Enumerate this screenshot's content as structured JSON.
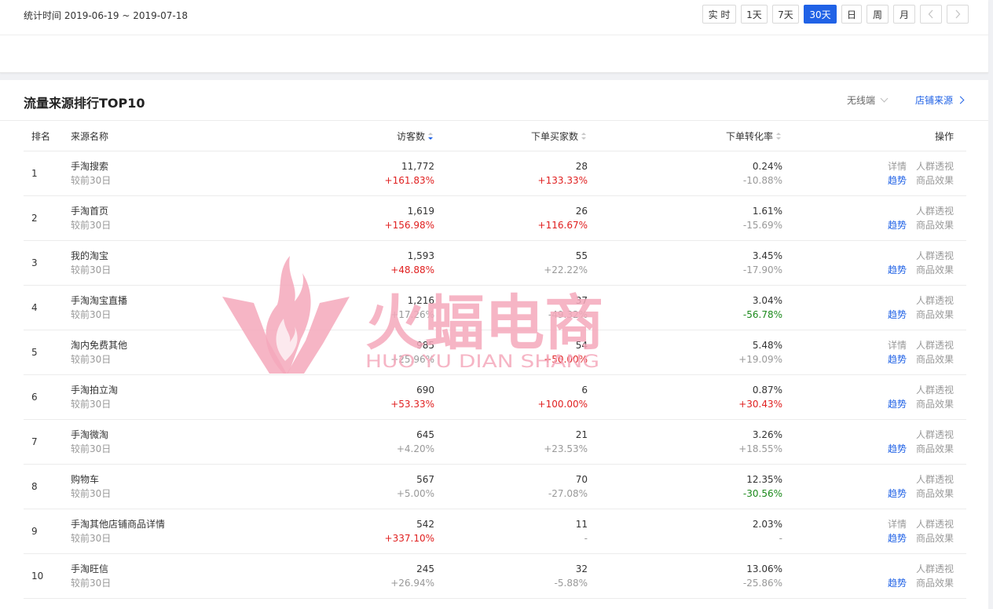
{
  "filter": {
    "stat_time": "统计时间 2019-06-19 ~ 2019-07-18",
    "ranges": [
      "实 时",
      "1天",
      "7天",
      "30天",
      "日",
      "周",
      "月"
    ],
    "active_range": "30天",
    "prev_icon": "chevron-left-icon",
    "next_icon": "chevron-right-icon"
  },
  "panel": {
    "title": "流量来源排行TOP10",
    "device": "无线端",
    "store_link": "店铺来源"
  },
  "table": {
    "headers": {
      "rank": "排名",
      "name": "来源名称",
      "visitors": "访客数",
      "buyers": "下单买家数",
      "conversion": "下单转化率",
      "ops": "操作"
    },
    "rows": [
      {
        "rank": "1",
        "name": "手淘搜索",
        "sub": "较前30日",
        "visitors": "11,772",
        "visitors_change": "+161.83%",
        "buyers": "28",
        "buyers_change": "+133.33%",
        "conversion": "0.24%",
        "conversion_change": "-10.88%"
      },
      {
        "rank": "2",
        "name": "手淘首页",
        "sub": "较前30日",
        "visitors": "1,619",
        "visitors_change": "+156.98%",
        "buyers": "26",
        "buyers_change": "+116.67%",
        "conversion": "1.61%",
        "conversion_change": "-15.69%"
      },
      {
        "rank": "3",
        "name": "我的淘宝",
        "sub": "较前30日",
        "visitors": "1,593",
        "visitors_change": "+48.88%",
        "buyers": "55",
        "buyers_change": "+22.22%",
        "conversion": "3.45%",
        "conversion_change": "-17.90%"
      },
      {
        "rank": "4",
        "name": "手淘淘宝直播",
        "sub": "较前30日",
        "visitors": "1,216",
        "visitors_change": "+17.26%",
        "buyers": "37",
        "buyers_change": "-49.32%",
        "conversion": "3.04%",
        "conversion_change": "-56.78%"
      },
      {
        "rank": "5",
        "name": "淘内免费其他",
        "sub": "较前30日",
        "visitors": "985",
        "visitors_change": "+25.96%",
        "buyers": "54",
        "buyers_change": "+50.00%",
        "conversion": "5.48%",
        "conversion_change": "+19.09%"
      },
      {
        "rank": "6",
        "name": "手淘拍立淘",
        "sub": "较前30日",
        "visitors": "690",
        "visitors_change": "+53.33%",
        "buyers": "6",
        "buyers_change": "+100.00%",
        "conversion": "0.87%",
        "conversion_change": "+30.43%"
      },
      {
        "rank": "7",
        "name": "手淘微淘",
        "sub": "较前30日",
        "visitors": "645",
        "visitors_change": "+4.20%",
        "buyers": "21",
        "buyers_change": "+23.53%",
        "conversion": "3.26%",
        "conversion_change": "+18.55%"
      },
      {
        "rank": "8",
        "name": "购物车",
        "sub": "较前30日",
        "visitors": "567",
        "visitors_change": "+5.00%",
        "buyers": "70",
        "buyers_change": "-27.08%",
        "conversion": "12.35%",
        "conversion_change": "-30.56%"
      },
      {
        "rank": "9",
        "name": "手淘其他店铺商品详情",
        "sub": "较前30日",
        "visitors": "542",
        "visitors_change": "+337.10%",
        "buyers": "11",
        "buyers_change": "-",
        "conversion": "2.03%",
        "conversion_change": "-"
      },
      {
        "rank": "10",
        "name": "手淘旺信",
        "sub": "较前30日",
        "visitors": "245",
        "visitors_change": "+26.94%",
        "buyers": "32",
        "buyers_change": "-5.88%",
        "conversion": "13.06%",
        "conversion_change": "-25.86%"
      }
    ],
    "change_colors": {
      "visitors_change": [
        "red",
        "red",
        "red",
        "gray",
        "gray",
        "red",
        "gray",
        "gray",
        "red",
        "gray"
      ],
      "buyers_change": [
        "red",
        "red",
        "gray",
        "gray",
        "red",
        "red",
        "gray",
        "gray",
        "gray",
        "gray"
      ],
      "conversion_change": [
        "gray",
        "gray",
        "gray",
        "green",
        "gray",
        "red",
        "gray",
        "green",
        "gray",
        "gray"
      ]
    },
    "ops": {
      "detail": "详情",
      "crowd": "人群透视",
      "trend": "趋势",
      "goods": "商品效果",
      "detail_rows": [
        0,
        4,
        8
      ]
    }
  },
  "watermark": {
    "text": "火蝠电商",
    "subtext": "HUO YU DIAN SHANG",
    "icon": "flame-bat-logo-icon"
  },
  "colors": {
    "accent": "#2062e6",
    "positive": "#e02020",
    "negative": "#1c8a1c",
    "watermark": "#f4a8bb"
  }
}
